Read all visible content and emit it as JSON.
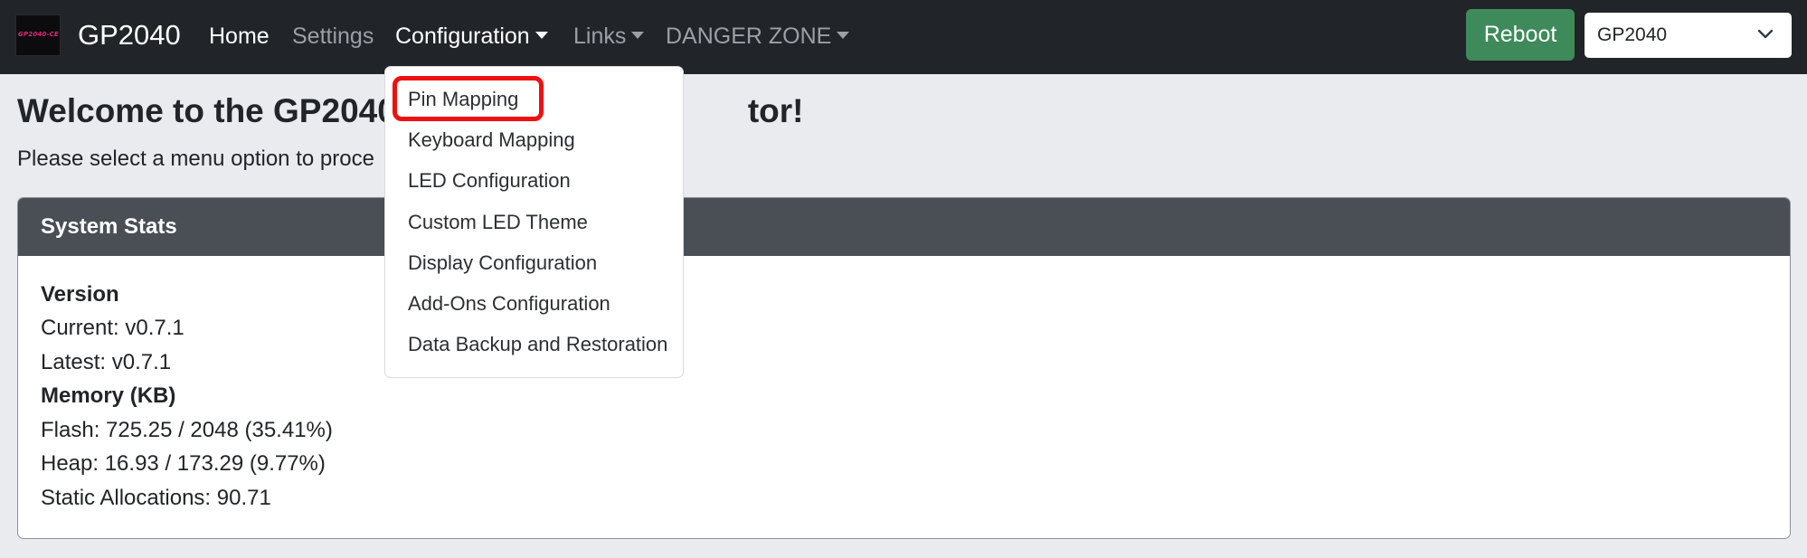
{
  "navbar": {
    "logo_text": "GP2040-CE",
    "brand": "GP2040",
    "links": {
      "home": "Home",
      "settings": "Settings",
      "configuration": "Configuration",
      "links": "Links",
      "danger_zone": "DANGER ZONE"
    },
    "reboot_label": "Reboot",
    "mode_select_value": "GP2040"
  },
  "main": {
    "title_start": "Welcome to the GP2040",
    "title_end": "tor!",
    "subtitle_start": "Please select a menu option to proce"
  },
  "system_stats": {
    "header": "System Stats",
    "version_heading": "Version",
    "current": "Current: v0.7.1",
    "latest": "Latest: v0.7.1",
    "memory_heading": "Memory (KB)",
    "flash": "Flash: 725.25 / 2048 (35.41%)",
    "heap": "Heap: 16.93 / 173.29 (9.77%)",
    "static_allocations": "Static Allocations: 90.71"
  },
  "configuration_menu": {
    "items": [
      "Pin Mapping",
      "Keyboard Mapping",
      "LED Configuration",
      "Custom LED Theme",
      "Display Configuration",
      "Add-Ons Configuration",
      "Data Backup and Restoration"
    ],
    "highlighted_item": "Pin Mapping"
  },
  "colors": {
    "navbar_bg": "#212529",
    "reboot_bg": "#3f8a5a",
    "card_header_bg": "#4a4f56",
    "page_bg": "#e9ebef",
    "highlight": "#ee1111"
  }
}
